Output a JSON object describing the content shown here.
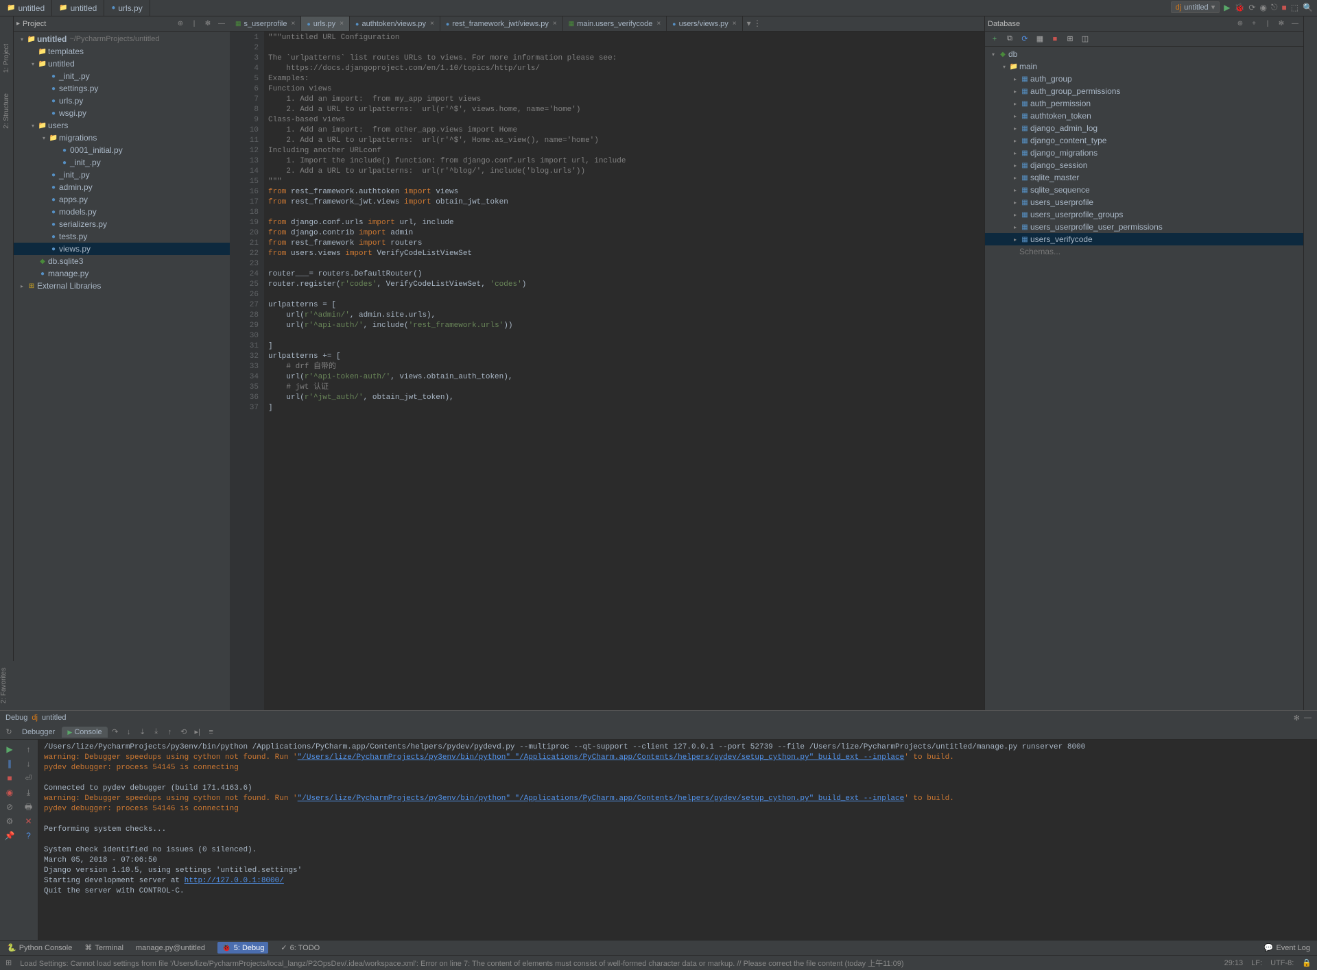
{
  "top_tabs": [
    {
      "label": "untitled",
      "icon": "folder"
    },
    {
      "label": "untitled",
      "icon": "folder"
    },
    {
      "label": "urls.py",
      "icon": "py"
    }
  ],
  "run_config": "untitled",
  "left_rail": [
    "1: Project",
    "2: Structure"
  ],
  "right_rail": [
    "Database"
  ],
  "project_panel": {
    "title": "Project"
  },
  "project_tree": [
    {
      "depth": 0,
      "arrow": "▾",
      "icon": "📁",
      "label": "untitled",
      "hint": "~/PycharmProjects/untitled",
      "bold": true
    },
    {
      "depth": 1,
      "arrow": " ",
      "icon": "📁",
      "label": "templates"
    },
    {
      "depth": 1,
      "arrow": "▾",
      "icon": "📁",
      "label": "untitled"
    },
    {
      "depth": 2,
      "arrow": " ",
      "icon": "py",
      "label": "_init_.py"
    },
    {
      "depth": 2,
      "arrow": " ",
      "icon": "py",
      "label": "settings.py"
    },
    {
      "depth": 2,
      "arrow": " ",
      "icon": "py",
      "label": "urls.py"
    },
    {
      "depth": 2,
      "arrow": " ",
      "icon": "py",
      "label": "wsgi.py"
    },
    {
      "depth": 1,
      "arrow": "▾",
      "icon": "📁",
      "label": "users"
    },
    {
      "depth": 2,
      "arrow": "▾",
      "icon": "📁",
      "label": "migrations"
    },
    {
      "depth": 3,
      "arrow": " ",
      "icon": "py",
      "label": "0001_initial.py"
    },
    {
      "depth": 3,
      "arrow": " ",
      "icon": "py",
      "label": "_init_.py"
    },
    {
      "depth": 2,
      "arrow": " ",
      "icon": "py",
      "label": "_init_.py"
    },
    {
      "depth": 2,
      "arrow": " ",
      "icon": "py",
      "label": "admin.py"
    },
    {
      "depth": 2,
      "arrow": " ",
      "icon": "py",
      "label": "apps.py"
    },
    {
      "depth": 2,
      "arrow": " ",
      "icon": "py",
      "label": "models.py"
    },
    {
      "depth": 2,
      "arrow": " ",
      "icon": "py",
      "label": "serializers.py"
    },
    {
      "depth": 2,
      "arrow": " ",
      "icon": "py",
      "label": "tests.py"
    },
    {
      "depth": 2,
      "arrow": " ",
      "icon": "py",
      "label": "views.py",
      "selected": true
    },
    {
      "depth": 1,
      "arrow": " ",
      "icon": "db",
      "label": "db.sqlite3"
    },
    {
      "depth": 1,
      "arrow": " ",
      "icon": "py",
      "label": "manage.py"
    },
    {
      "depth": 0,
      "arrow": "▸",
      "icon": "lib",
      "label": "External Libraries"
    }
  ],
  "editor_tabs": [
    {
      "label": "s_userprofile",
      "icon": "tbl",
      "close": true
    },
    {
      "label": "urls.py",
      "icon": "py",
      "active": true,
      "close": true
    },
    {
      "label": "authtoken/views.py",
      "icon": "py",
      "close": true
    },
    {
      "label": "rest_framework_jwt/views.py",
      "icon": "py",
      "close": true
    },
    {
      "label": "main.users_verifycode",
      "icon": "tbl",
      "close": true
    },
    {
      "label": "users/views.py",
      "icon": "py",
      "close": true
    }
  ],
  "code_lines": [
    {
      "n": 1,
      "html": "<span class='cm'>\"\"\"untitled URL Configuration</span>"
    },
    {
      "n": 2,
      "html": ""
    },
    {
      "n": 3,
      "html": "<span class='cm'>The `urlpatterns` list routes URLs to views. For more information please see:</span>"
    },
    {
      "n": 4,
      "html": "<span class='cm'>    https://docs.djangoproject.com/en/1.10/topics/http/urls/</span>"
    },
    {
      "n": 5,
      "html": "<span class='cm'>Examples:</span>"
    },
    {
      "n": 6,
      "html": "<span class='cm'>Function views</span>"
    },
    {
      "n": 7,
      "html": "<span class='cm'>    1. Add an import:  from my_app import views</span>"
    },
    {
      "n": 8,
      "html": "<span class='cm'>    2. Add a URL to urlpatterns:  url(r'^$', views.home, name='home')</span>"
    },
    {
      "n": 9,
      "html": "<span class='cm'>Class-based views</span>"
    },
    {
      "n": 10,
      "html": "<span class='cm'>    1. Add an import:  from other_app.views import Home</span>"
    },
    {
      "n": 11,
      "html": "<span class='cm'>    2. Add a URL to urlpatterns:  url(r'^$', Home.as_view(), name='home')</span>"
    },
    {
      "n": 12,
      "html": "<span class='cm'>Including another URLconf</span>"
    },
    {
      "n": 13,
      "html": "<span class='cm'>    1. Import the include() function: from django.conf.urls import url, include</span>"
    },
    {
      "n": 14,
      "html": "<span class='cm'>    2. Add a URL to urlpatterns:  url(r'^blog/', include('blog.urls'))</span>"
    },
    {
      "n": 15,
      "html": "<span class='cm'>\"\"\"</span>"
    },
    {
      "n": 16,
      "html": "<span class='kw'>from</span> rest_framework.authtoken <span class='kw'>import</span> views"
    },
    {
      "n": 17,
      "html": "<span class='kw'>from</span> rest_framework_jwt.views <span class='kw'>import</span> obtain_jwt_token"
    },
    {
      "n": 18,
      "html": ""
    },
    {
      "n": 19,
      "html": "<span class='kw'>from</span> django.conf.urls <span class='kw'>import</span> url, include"
    },
    {
      "n": 20,
      "html": "<span class='kw'>from</span> django.contrib <span class='kw'>import</span> admin"
    },
    {
      "n": 21,
      "html": "<span class='kw'>from</span> rest_framework <span class='kw'>import</span> routers"
    },
    {
      "n": 22,
      "html": "<span class='kw'>from</span> users.views <span class='kw'>import</span> VerifyCodeListViewSet"
    },
    {
      "n": 23,
      "html": ""
    },
    {
      "n": 24,
      "html": "router___= routers.DefaultRouter()"
    },
    {
      "n": 25,
      "html": "router.register(<span class='str'>r'codes'</span>, VerifyCodeListViewSet, <span class='str'>'codes'</span>)"
    },
    {
      "n": 26,
      "html": ""
    },
    {
      "n": 27,
      "html": "urlpatterns = ["
    },
    {
      "n": 28,
      "html": "    url(<span class='str'>r'^admin/'</span>, admin.site.urls),"
    },
    {
      "n": 29,
      "html": "    url(<span class='str'>r'^api-auth/'</span>, include(<span class='str'>'rest_framework.urls'</span>))"
    },
    {
      "n": 30,
      "html": ""
    },
    {
      "n": 31,
      "html": "]"
    },
    {
      "n": 32,
      "html": "urlpatterns += ["
    },
    {
      "n": 33,
      "html": "    <span class='cm'># drf 自带的</span>"
    },
    {
      "n": 34,
      "html": "    url(<span class='str'>r'^api-token-auth/'</span>, views.obtain_auth_token),"
    },
    {
      "n": 35,
      "html": "    <span class='cm'># jwt 认证</span>"
    },
    {
      "n": 36,
      "html": "    url(<span class='str'>r'^jwt_auth/'</span>, obtain_jwt_token),"
    },
    {
      "n": 37,
      "html": "]"
    }
  ],
  "db_panel": {
    "title": "Database"
  },
  "db_tree": [
    {
      "depth": 0,
      "arrow": "▾",
      "icon": "db",
      "label": "db"
    },
    {
      "depth": 1,
      "arrow": "▾",
      "icon": "📁",
      "label": "main"
    },
    {
      "depth": 2,
      "arrow": "▸",
      "icon": "tbl",
      "label": "auth_group"
    },
    {
      "depth": 2,
      "arrow": "▸",
      "icon": "tbl",
      "label": "auth_group_permissions"
    },
    {
      "depth": 2,
      "arrow": "▸",
      "icon": "tbl",
      "label": "auth_permission"
    },
    {
      "depth": 2,
      "arrow": "▸",
      "icon": "tbl",
      "label": "authtoken_token"
    },
    {
      "depth": 2,
      "arrow": "▸",
      "icon": "tbl",
      "label": "django_admin_log"
    },
    {
      "depth": 2,
      "arrow": "▸",
      "icon": "tbl",
      "label": "django_content_type"
    },
    {
      "depth": 2,
      "arrow": "▸",
      "icon": "tbl",
      "label": "django_migrations"
    },
    {
      "depth": 2,
      "arrow": "▸",
      "icon": "tbl",
      "label": "django_session"
    },
    {
      "depth": 2,
      "arrow": "▸",
      "icon": "tbl",
      "label": "sqlite_master"
    },
    {
      "depth": 2,
      "arrow": "▸",
      "icon": "tbl",
      "label": "sqlite_sequence"
    },
    {
      "depth": 2,
      "arrow": "▸",
      "icon": "tbl",
      "label": "users_userprofile"
    },
    {
      "depth": 2,
      "arrow": "▸",
      "icon": "tbl",
      "label": "users_userprofile_groups"
    },
    {
      "depth": 2,
      "arrow": "▸",
      "icon": "tbl",
      "label": "users_userprofile_user_permissions"
    },
    {
      "depth": 2,
      "arrow": "▸",
      "icon": "tbl",
      "label": "users_verifycode",
      "selected": true
    },
    {
      "depth": 1,
      "arrow": " ",
      "icon": " ",
      "label": "Schemas...",
      "dim": true
    }
  ],
  "debug": {
    "title": "Debug",
    "config": "untitled",
    "tabs": [
      "Debugger",
      "Console"
    ]
  },
  "console_lines": [
    {
      "html": "/Users/lize/PycharmProjects/py3env/bin/python /Applications/PyCharm.app/Contents/helpers/pydev/pydevd.py --multiproc --qt-support --client 127.0.0.1 --port 52739 --file /Users/lize/PycharmProjects/untitled/manage.py runserver 8000"
    },
    {
      "html": "<span class='warn'>warning: Debugger speedups using cython not found. Run '</span><span class='link'>\"/Users/lize/PycharmProjects/py3env/bin/python\" \"/Applications/PyCharm.app/Contents/helpers/pydev/setup_cython.py\" build_ext --inplace</span><span class='warn'>' to build.</span>"
    },
    {
      "html": "<span class='warn'>pydev debugger: process 54145 is connecting</span>"
    },
    {
      "html": ""
    },
    {
      "html": "Connected to pydev debugger (build 171.4163.6)"
    },
    {
      "html": "<span class='warn'>warning: Debugger speedups using cython not found. Run '</span><span class='link'>\"/Users/lize/PycharmProjects/py3env/bin/python\" \"/Applications/PyCharm.app/Contents/helpers/pydev/setup_cython.py\" build_ext --inplace</span><span class='warn'>' to build.</span>"
    },
    {
      "html": "<span class='warn'>pydev debugger: process 54146 is connecting</span>"
    },
    {
      "html": ""
    },
    {
      "html": "Performing system checks..."
    },
    {
      "html": ""
    },
    {
      "html": "System check identified no issues (0 silenced)."
    },
    {
      "html": "March 05, 2018 - 07:06:50"
    },
    {
      "html": "Django version 1.10.5, using settings 'untitled.settings'"
    },
    {
      "html": "Starting development server at <span class='link'>http://127.0.0.1:8000/</span>"
    },
    {
      "html": "Quit the server with CONTROL-C."
    }
  ],
  "bottom_tabs": [
    {
      "label": "Python Console",
      "icon": "🐍"
    },
    {
      "label": "Terminal",
      "icon": "⌘"
    },
    {
      "label": "manage.py@untitled"
    },
    {
      "label": "5: Debug",
      "icon": "🐞",
      "active": true
    },
    {
      "label": "6: TODO",
      "icon": "✓"
    }
  ],
  "event_log": "Event Log",
  "status": {
    "msg": "Load Settings: Cannot load settings from file '/Users/lize/PycharmProjects/local_langz/P2OpsDev/.idea/workspace.xml': Error on line 7: The content of elements must consist of well-formed character data or markup. // Please correct the file content (today 上午11:09)",
    "pos": "29:13",
    "sep": "LF:",
    "enc": "UTF-8:"
  }
}
